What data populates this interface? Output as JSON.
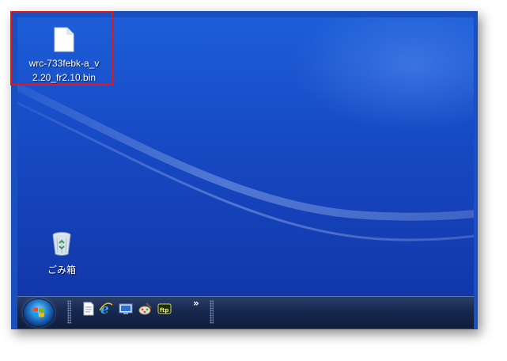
{
  "desktop": {
    "icons": [
      {
        "label_line1": "wrc-733febk-a_v",
        "label_line2": "2.20_fr2.10.bin",
        "icon": "file-icon"
      },
      {
        "label": "ごみ箱",
        "icon": "recycle-bin-icon"
      }
    ]
  },
  "taskbar": {
    "start_icon": "windows-start-orb",
    "quick_launch": [
      "notepad-icon",
      "internet-explorer-icon",
      "show-desktop-icon",
      "paint-icon",
      "ftp-icon"
    ],
    "more_label": "»"
  },
  "annotation": {
    "color": "#e01818",
    "target": "file-icon"
  }
}
